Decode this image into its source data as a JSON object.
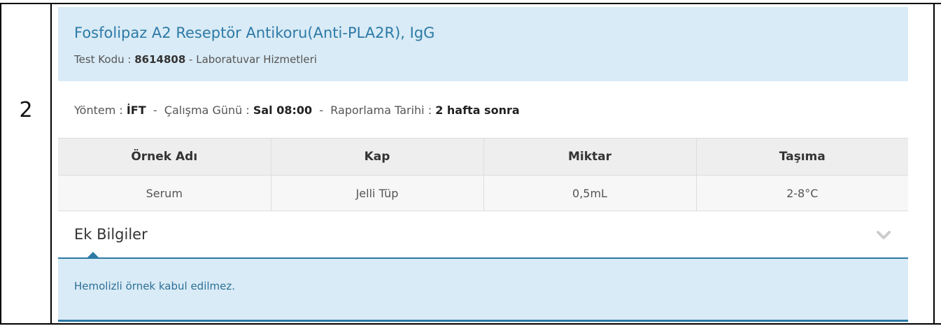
{
  "row_number": "2",
  "test": {
    "title": "Fosfolipaz A2 Reseptör Antikoru(Anti-PLA2R), IgG",
    "code_label": "Test Kodu : ",
    "code": "8614808",
    "department": " - Laboratuvar Hizmetleri"
  },
  "meta": {
    "method_label": "Yöntem : ",
    "method": "İFT",
    "sep1": "  -  ",
    "work_day_label": "Çalışma Günü : ",
    "work_day": "Sal 08:00",
    "sep2": "  -  ",
    "report_label": "Raporlama Tarihi : ",
    "report": "2 hafta sonra"
  },
  "samples": {
    "headers": [
      "Örnek Adı",
      "Kap",
      "Miktar",
      "Taşıma"
    ],
    "rows": [
      [
        "Serum",
        "Jelli Tüp",
        "0,5mL",
        "2-8°C"
      ]
    ]
  },
  "additional": {
    "title": "Ek Bilgiler",
    "icon": "chevron-down-icon",
    "text": "Hemolizli örnek kabul edilmez."
  },
  "colors": {
    "accent": "#2d7aa6",
    "header_bg": "#d9ebf6"
  }
}
